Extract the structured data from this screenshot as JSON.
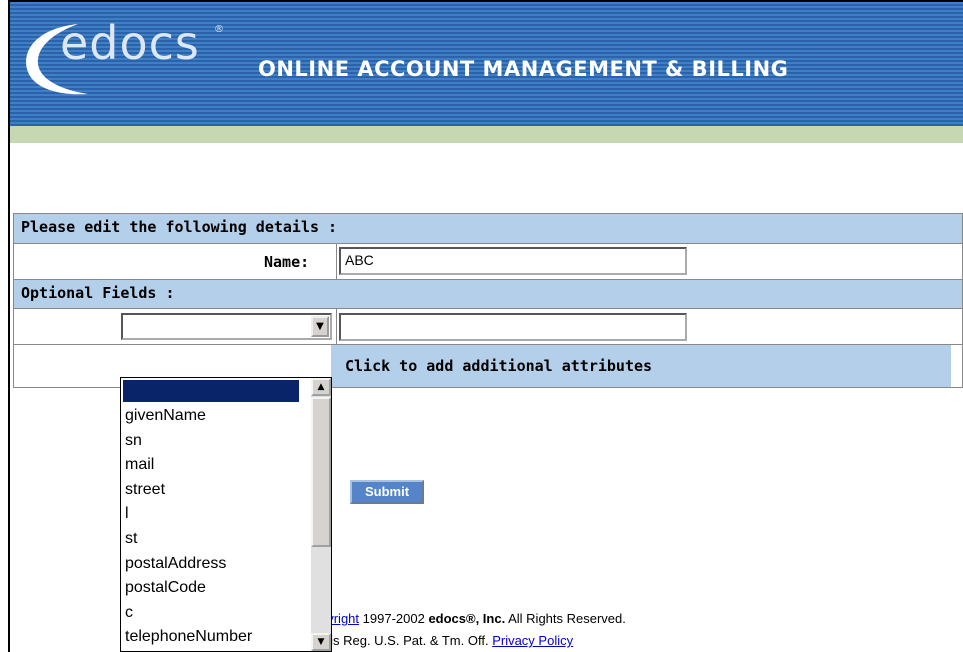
{
  "banner": {
    "logo": "edocs",
    "logo_reg": "®",
    "title": "ONLINE ACCOUNT MANAGEMENT & BILLING"
  },
  "form": {
    "section_header": "Please edit the following details :",
    "name_label": "Name:",
    "name_value": "ABC",
    "optional_header": "Optional Fields :",
    "optional_value": "",
    "add_attributes": "Click to add additional attributes",
    "submit_label": "Submit"
  },
  "dropdown": {
    "options": [
      "givenName",
      "sn",
      "mail",
      "street",
      "l",
      "st",
      "postalAddress",
      "postalCode",
      "c",
      "telephoneNumber"
    ]
  },
  "footer": {
    "copyright_link": "pyright",
    "copyright_text": " 1997-2002 ",
    "company": "edocs®, Inc.",
    "rights": " All Rights Reserved.",
    "trademark_text": "s is Reg. U.S. Pat. & Tm. Off. ",
    "privacy_link": "Privacy Policy"
  },
  "colors": {
    "banner_blue": "#2f6db6",
    "header_blue": "#b4cfe9",
    "green_bar": "#c5d8b2",
    "list_selected": "#0a246a"
  }
}
